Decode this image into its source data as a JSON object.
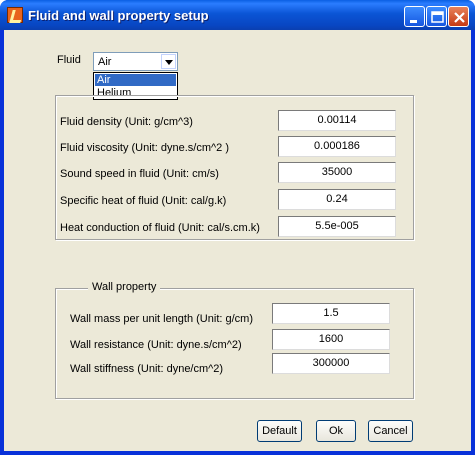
{
  "window": {
    "title": "Fluid and wall property setup"
  },
  "fluid": {
    "label": "Fluid",
    "selected": "Air",
    "options": [
      "Air",
      "Helium"
    ]
  },
  "fluid_properties": [
    {
      "label": "Fluid density (Unit: g/cm^3)",
      "value": "0.00114"
    },
    {
      "label": "Fluid viscosity (Unit: dyne.s/cm^2 )",
      "value": "0.000186"
    },
    {
      "label": "Sound speed in fluid (Unit: cm/s)",
      "value": "35000"
    },
    {
      "label": "Specific heat of fluid (Unit: cal/g.k)",
      "value": "0.24"
    },
    {
      "label": "Heat conduction of fluid (Unit: cal/s.cm.k)",
      "value": "5.5e-005"
    }
  ],
  "wall": {
    "title": "Wall property",
    "properties": [
      {
        "label": "Wall mass per unit length (Unit: g/cm)",
        "value": "1.5"
      },
      {
        "label": "Wall resistance (Unit: dyne.s/cm^2)",
        "value": "1600"
      },
      {
        "label": "Wall stiffness (Unit: dyne/cm^2)",
        "value": "300000"
      }
    ]
  },
  "buttons": {
    "default": "Default",
    "ok": "Ok",
    "cancel": "Cancel"
  },
  "colors": {
    "titlebar": "#0a53d6",
    "face": "#ece9d8",
    "selection": "#316ac5",
    "close": "#c63a14"
  }
}
